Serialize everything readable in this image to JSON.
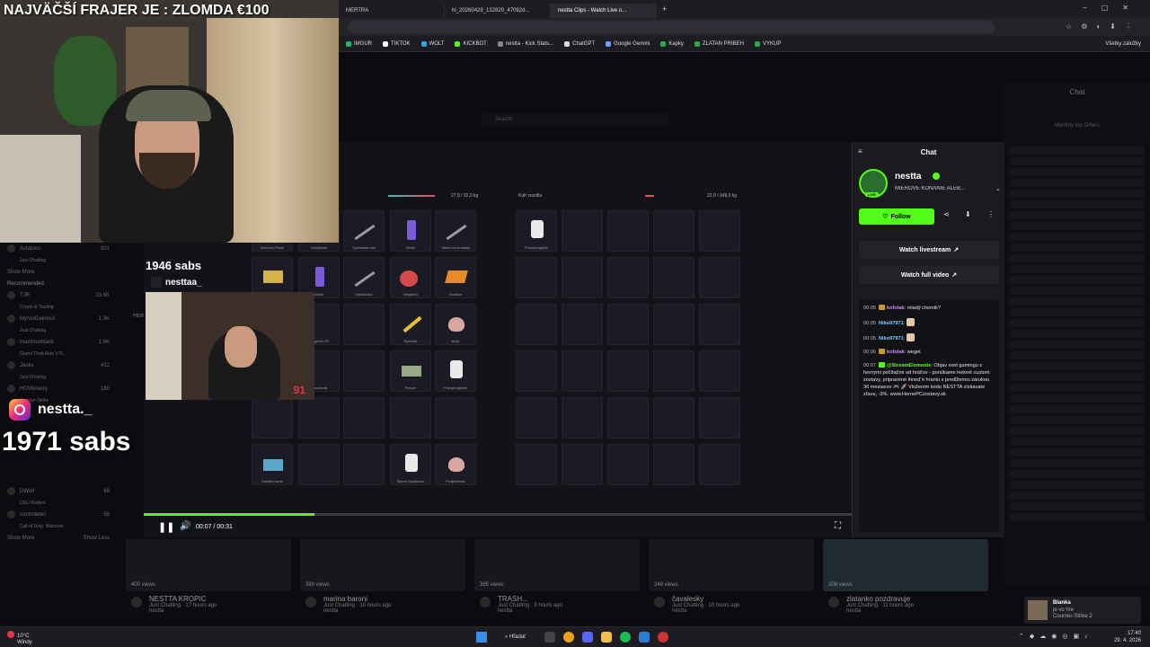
{
  "headline": "NAJVÄČŠÍ FRAJER JE : ZLOMDA €100",
  "browser": {
    "tabs": [
      {
        "label": "MERTRA"
      },
      {
        "label": "hl_20260429_132820_47092d..."
      },
      {
        "label": "nestta Clips - Watch Live o..."
      }
    ],
    "bookmarks": [
      "IMGUR",
      "TIKTOK",
      "WOLT",
      "KICKBOT",
      "nestta - Kick Stats...",
      "ChatGPT",
      "Google Gemini",
      "Kapky",
      "ZLATAN PRIBEH",
      "VYKUP"
    ],
    "all_bookmarks": "Všetky záložky"
  },
  "page": {
    "search_placeholder": "Search",
    "sidebar_recommended": "Recommended",
    "sidebar_following": [
      {
        "name": "Astatoos",
        "sub": "Just Chatting",
        "count": "901"
      },
      {
        "name": "TJR",
        "sub": "Crypto & Trading",
        "count": "10.6K"
      },
      {
        "name": "MyronGainesX",
        "sub": "Just Chatting",
        "count": "1.3K"
      },
      {
        "name": "maximuxblack",
        "sub": "Grand Theft Auto V R...",
        "count": "1.6K"
      },
      {
        "name": "Jaoks",
        "sub": "Just Chatting",
        "count": "432"
      },
      {
        "name": "HOVbreezy",
        "sub": "Counter-Strike",
        "count": "180"
      },
      {
        "name": "DWolf",
        "sub": "OSU Rodent",
        "count": "69"
      },
      {
        "name": "controletec",
        "sub": "Call of Duty: Warzone",
        "count": "58"
      }
    ],
    "show_more": "Show More",
    "show_less": "Show Less",
    "home_label": "Hom",
    "right_chat_title": "Chat",
    "right_top_gifters": "Monthly top Gifters",
    "clips": [
      {
        "views": "400 views",
        "title": "NESTTA KROPIC",
        "sub": "Just Chatting · 17 hours ago",
        "author": "nestta"
      },
      {
        "views": "389 views",
        "title": "marina baroni",
        "sub": "Just Chatting · 10 hours ago",
        "author": "nestta"
      },
      {
        "views": "385 views",
        "title": "TRASH...",
        "sub": "Just Chatting · 9 hours ago",
        "author": "nestta"
      },
      {
        "views": "348 views",
        "title": "čavalesky",
        "sub": "Just Chatting · 10 hours ago",
        "author": "nestta"
      },
      {
        "views": "308 views",
        "title": "zlatanko pozdravuje",
        "sub": "Just Chatting · 11 hours ago",
        "author": "nestta"
      }
    ]
  },
  "video": {
    "time": "00:07 / 00:31",
    "progress_fraction": 0.24,
    "inventory_weight_left": "27,9 / 32,0 kg",
    "inventory_title_right": "Kufr vozidla",
    "inventory_weight_right": "22,9 / 348,0 kg",
    "slot_labels": [
      "Machine Pistol",
      "Dobíjačka",
      "Vysielacia náš",
      "Mobil",
      "Tablet na kontakty",
      "Propylenglykol",
      "Mobil",
      "Vysielačka",
      "Megafon",
      "Krabice",
      "Jerigerův ÚF",
      "Šperhák",
      "Brýle",
      "Šroubovák",
      "Peníze",
      "Propylenglykol",
      "Zvláštní karta",
      "Stepni Zapalovač",
      "Podprsenka"
    ]
  },
  "card": {
    "title": "Chat",
    "streamer": "nestta",
    "live_badge": "LIVE",
    "status": "MIEROVÉ KONANIE ALEB...",
    "follow_label": "Follow",
    "watch_livestream": "Watch livestream",
    "watch_full_video": "Watch full video",
    "messages": [
      {
        "time": "00:05",
        "user": "kofolak",
        "text": "mladý chemik?"
      },
      {
        "time": "00:05",
        "user": "Niko97971",
        "text": ""
      },
      {
        "time": "00:05",
        "user": "Niko97971",
        "text": ""
      },
      {
        "time": "00:06",
        "user": "kofolak",
        "text": "weget"
      },
      {
        "time": "00:07",
        "user": "@StreamElements",
        "text": "Objav svet gamingu s hernými počítačmi od hráčov - ponúkame hotové custom zostavy, pripravené ihneď k hraniu s predĺženou zárukou 36 mesiacov 🎮 🚀 Vložením kódu NESTTA získavate zľavu, -3%. www.HernePCzostavy.sk"
      }
    ]
  },
  "overlays": {
    "subs_small": "1946 sabs",
    "tiktok_handle": "nesttaa_",
    "instagram_handle": "nestta._",
    "subs_big": "1971 sabs",
    "cam2_number": "91"
  },
  "notification": {
    "title": "Blanka",
    "line1": "je vo hre",
    "line2": "Counter-Strike 2"
  },
  "taskbar": {
    "weather_temp": "10°C",
    "weather_desc": "Windy",
    "search": "Hľadať",
    "time": "17:40",
    "date": "29. 4. 2026"
  }
}
